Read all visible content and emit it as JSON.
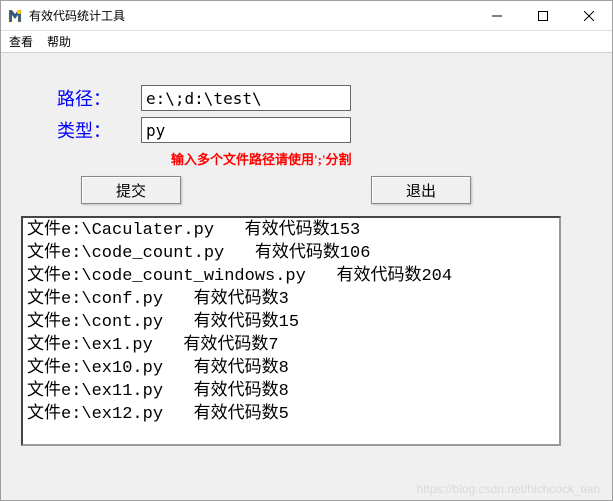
{
  "window": {
    "title": "有效代码统计工具"
  },
  "menubar": {
    "items": [
      "查看",
      "帮助"
    ]
  },
  "form": {
    "path_label": "路径：",
    "path_value": "e:\\;d:\\test\\",
    "type_label": "类型：",
    "type_value": "py",
    "hint": "输入多个文件路径请使用';'分割"
  },
  "buttons": {
    "submit": "提交",
    "exit": "退出"
  },
  "output": {
    "lines": [
      "文件e:\\Caculater.py   有效代码数153",
      "文件e:\\code_count.py   有效代码数106",
      "文件e:\\code_count_windows.py   有效代码数204",
      "文件e:\\conf.py   有效代码数3",
      "文件e:\\cont.py   有效代码数15",
      "文件e:\\ex1.py   有效代码数7",
      "文件e:\\ex10.py   有效代码数8",
      "文件e:\\ex11.py   有效代码数8",
      "文件e:\\ex12.py   有效代码数5"
    ]
  },
  "watermark": "https://blog.csdn.net/hichcock_tian"
}
